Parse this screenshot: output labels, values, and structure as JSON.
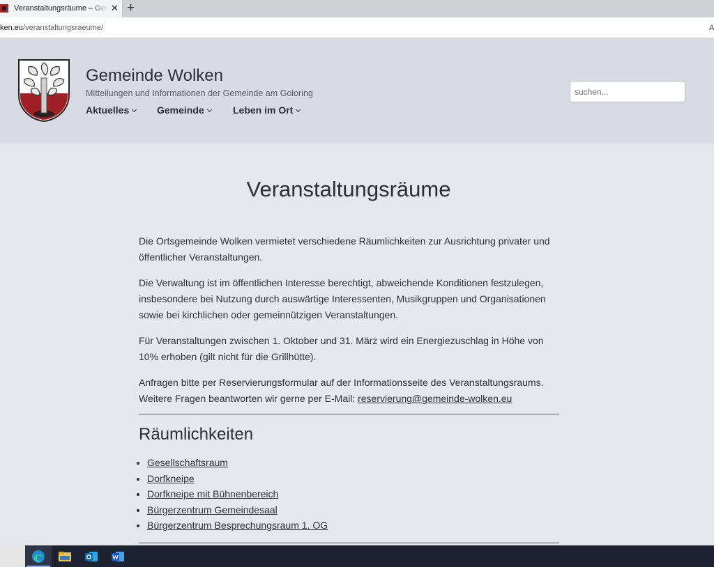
{
  "browser": {
    "tab_title": "Veranstaltungsräume – Gemeinde Wolken",
    "close_label": "✕",
    "new_tab_label": "+",
    "url_host": "ken.eu",
    "url_path": "/veranstaltungsraeume/",
    "reader_label": "A"
  },
  "header": {
    "title": "Gemeinde Wolken",
    "tagline": "Mitteilungen und Informationen der Gemeinde am Goloring",
    "nav": [
      {
        "label": "Aktuelles"
      },
      {
        "label": "Gemeinde"
      },
      {
        "label": "Leben im Ort"
      }
    ],
    "search_placeholder": "suchen..."
  },
  "main": {
    "title": "Veranstaltungsräume",
    "paragraphs": [
      "Die Ortsgemeinde Wolken vermietet verschiedene Räumlichkeiten zur Ausrichtung privater und öffentlicher Veranstaltungen.",
      "Die Verwaltung ist im öffentlichen Interesse berechtigt, abweichende Konditionen festzulegen, insbesondere bei Nutzung durch auswärtige Interessenten, Musikgruppen und Organisationen sowie bei kirchlichen oder gemeinnützigen Veranstaltungen.",
      "Für Veranstaltungen zwischen 1. Oktober und 31. März wird ein Energiezuschlag in Höhe von 10% erhoben (gilt nicht für die Grillhütte)."
    ],
    "contact_text": "Anfragen bitte per Reservierungsformular auf der Informationsseite des Veranstaltungsraums. Weitere Fragen beantworten wir gerne per E-Mail: ",
    "contact_email": "reservierung@gemeinde-wolken.eu",
    "rooms_heading": "Räumlichkeiten",
    "rooms": [
      {
        "label": "Gesellschaftsraum"
      },
      {
        "label": "Dorfkneipe"
      },
      {
        "label": "Dorfkneipe mit Bühnenbereich"
      },
      {
        "label": "Bürgerzentrum Gemeindesaal"
      },
      {
        "label": "Bürgerzentrum Besprechungsraum 1. OG"
      }
    ]
  },
  "taskbar": {
    "apps": [
      {
        "icon": "edge-icon",
        "active": true
      },
      {
        "icon": "file-explorer-icon",
        "active": false
      },
      {
        "icon": "outlook-icon",
        "active": false
      },
      {
        "icon": "word-icon",
        "active": false
      }
    ]
  },
  "colors": {
    "header_bg": "#d8dbe4",
    "page_bg": "#e7e8ee",
    "text": "#2b2f36",
    "taskbar": "#1c2230"
  }
}
